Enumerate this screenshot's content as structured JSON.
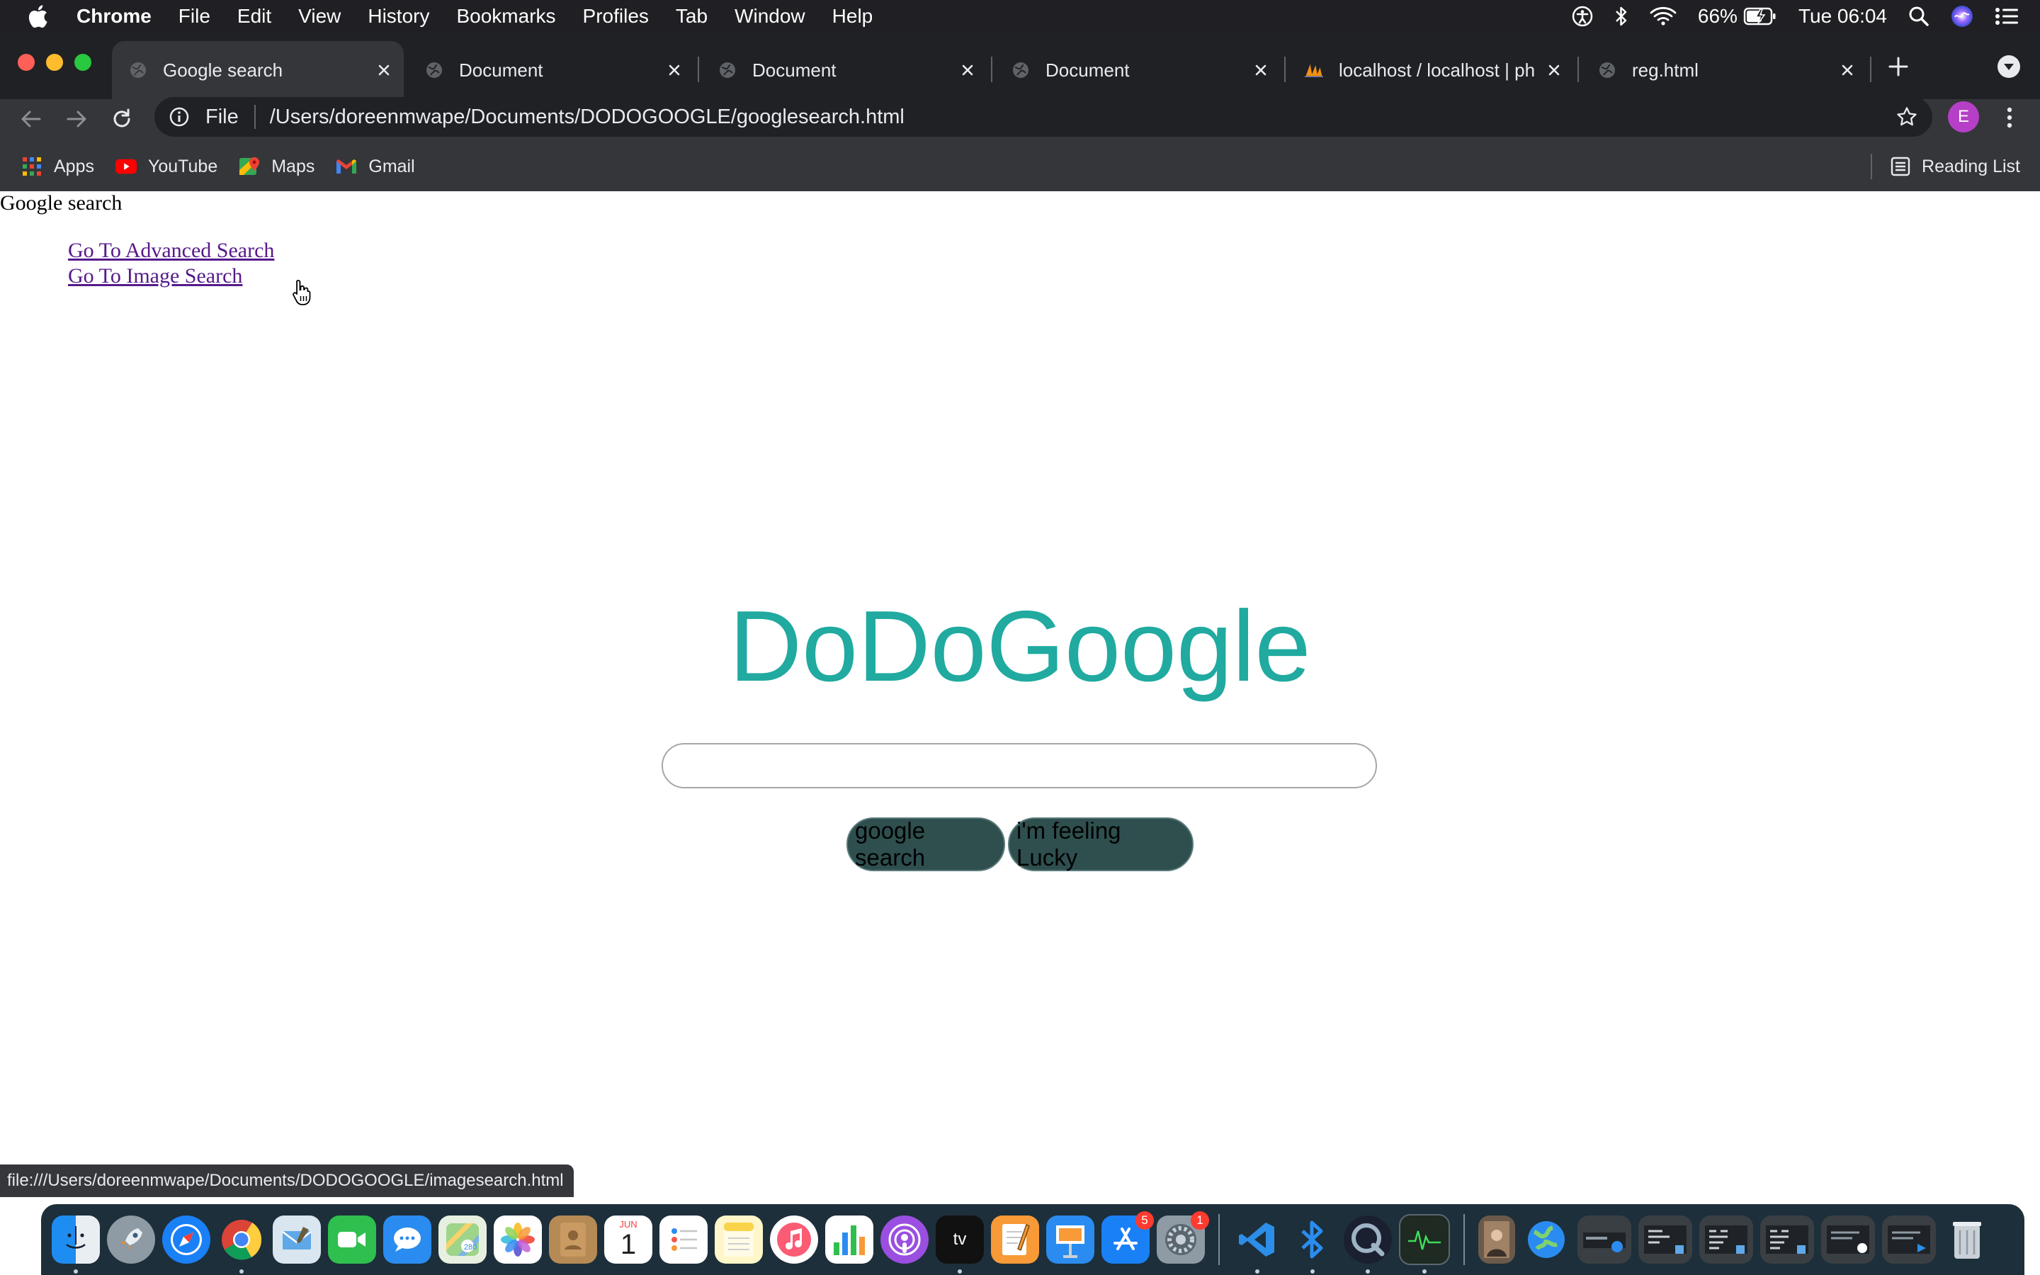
{
  "menubar": {
    "app_name": "Chrome",
    "items": [
      "File",
      "Edit",
      "View",
      "History",
      "Bookmarks",
      "Profiles",
      "Tab",
      "Window",
      "Help"
    ],
    "battery": "66%",
    "clock": "Tue 06:04"
  },
  "tabs": [
    {
      "title": "Google search",
      "active": true
    },
    {
      "title": "Document",
      "active": false
    },
    {
      "title": "Document",
      "active": false
    },
    {
      "title": "Document",
      "active": false
    },
    {
      "title": "localhost / localhost | ph",
      "active": false
    },
    {
      "title": "reg.html",
      "active": false
    }
  ],
  "omnibox": {
    "scheme_label": "File",
    "url": "/Users/doreenmwape/Documents/DODOGOOGLE/googlesearch.html"
  },
  "profile_initial": "E",
  "bookmarks": [
    "Apps",
    "YouTube",
    "Maps",
    "Gmail"
  ],
  "reading_list_label": "Reading List",
  "page": {
    "heading": "Google search",
    "links": [
      "Go To Advanced Search",
      "Go To Image Search"
    ],
    "logo": "DoDoGoogle",
    "search_value": "",
    "buttons": [
      "google search",
      "i'm feeling Lucky"
    ],
    "logo_color": "#20aaa0",
    "button_color": "#2f4f4f"
  },
  "status_url": "file:///Users/doreenmwape/Documents/DODOGOOGLE/imagesearch.html",
  "dock": {
    "apps": [
      "finder-icon",
      "launchpad-icon",
      "safari-icon",
      "chrome-icon",
      "mail-icon",
      "facetime-icon",
      "messages-icon",
      "maps-icon",
      "photos-icon",
      "contacts-icon",
      "calendar-icon",
      "reminders-icon",
      "notes-icon",
      "music-icon",
      "numbers-icon",
      "podcasts-icon",
      "tv-icon",
      "pages-icon",
      "keynote-icon",
      "app-store-icon",
      "system-preferences-icon",
      "vscode-icon",
      "bluetooth-icon",
      "quicktime-icon",
      "activity-monitor-icon"
    ],
    "calendar_month": "JUN",
    "calendar_day": "1",
    "tv_label": "tv",
    "app_store_badge": "5",
    "system_preferences_badge": "1"
  }
}
